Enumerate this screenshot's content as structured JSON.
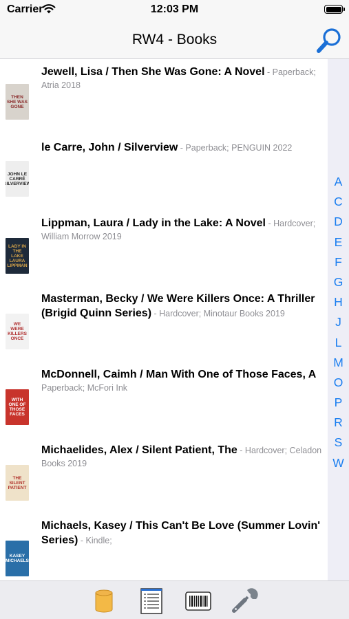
{
  "status_bar": {
    "carrier": "Carrier",
    "time": "12:03 PM"
  },
  "nav": {
    "title": "RW4 - Books",
    "search_icon": "search-icon"
  },
  "books": [
    {
      "title": "Jewell, Lisa / Then She Was Gone: A Novel",
      "details": " - Paperback; Atria 2018",
      "cover_text": "THEN SHE WAS GONE",
      "cover_bg": "#d8d3cc",
      "cover_fg": "#8a2a2a"
    },
    {
      "title": "le Carre, John / Silverview",
      "details": " - Paperback; PENGUIN 2022",
      "cover_text": "JOHN LE CARRÉ SILVERVIEW",
      "cover_bg": "#eeeeee",
      "cover_fg": "#222222"
    },
    {
      "title": "Lippman, Laura / Lady in the Lake: A Novel",
      "details": " - Hardcover; William Morrow 2019",
      "cover_text": "LADY IN THE LAKE LAURA LIPPMAN",
      "cover_bg": "#1e2a3a",
      "cover_fg": "#d9a64a"
    },
    {
      "title": "Masterman, Becky / We Were Killers Once: A Thriller (Brigid Quinn Series)",
      "details": " - Hardcover; Minotaur Books 2019",
      "cover_text": "WE WERE KILLERS ONCE",
      "cover_bg": "#f2f2f2",
      "cover_fg": "#b03030"
    },
    {
      "title": "McDonnell, Caimh / Man With One of Those Faces, A",
      "details": " Paperback; McFori Ink",
      "cover_text": "WITH ONE OF THOSE FACES",
      "cover_bg": "#c8342c",
      "cover_fg": "#ffffff"
    },
    {
      "title": "Michaelides, Alex / Silent Patient, The",
      "details": " - Hardcover; Celadon Books 2019",
      "cover_text": "THE SILENT PATIENT",
      "cover_bg": "#efe2c9",
      "cover_fg": "#b0322a"
    },
    {
      "title": "Michaels, Kasey / This Can't Be Love (Summer Lovin' Series)",
      "details": " - Kindle;",
      "cover_text": "KASEY MICHAELS",
      "cover_bg": "#2a6fa8",
      "cover_fg": "#ffffff"
    }
  ],
  "index_letters": [
    "A",
    "C",
    "D",
    "E",
    "F",
    "G",
    "H",
    "J",
    "L",
    "M",
    "O",
    "P",
    "R",
    "S",
    "W"
  ],
  "tabs": [
    {
      "name": "database-icon"
    },
    {
      "name": "list-icon"
    },
    {
      "name": "barcode-icon"
    },
    {
      "name": "wrench-icon"
    }
  ],
  "colors": {
    "accent": "#1a7ef0",
    "subtext": "#8e8e93",
    "bar_bg": "#f7f7f7",
    "rail_bg": "#eeeef6"
  }
}
